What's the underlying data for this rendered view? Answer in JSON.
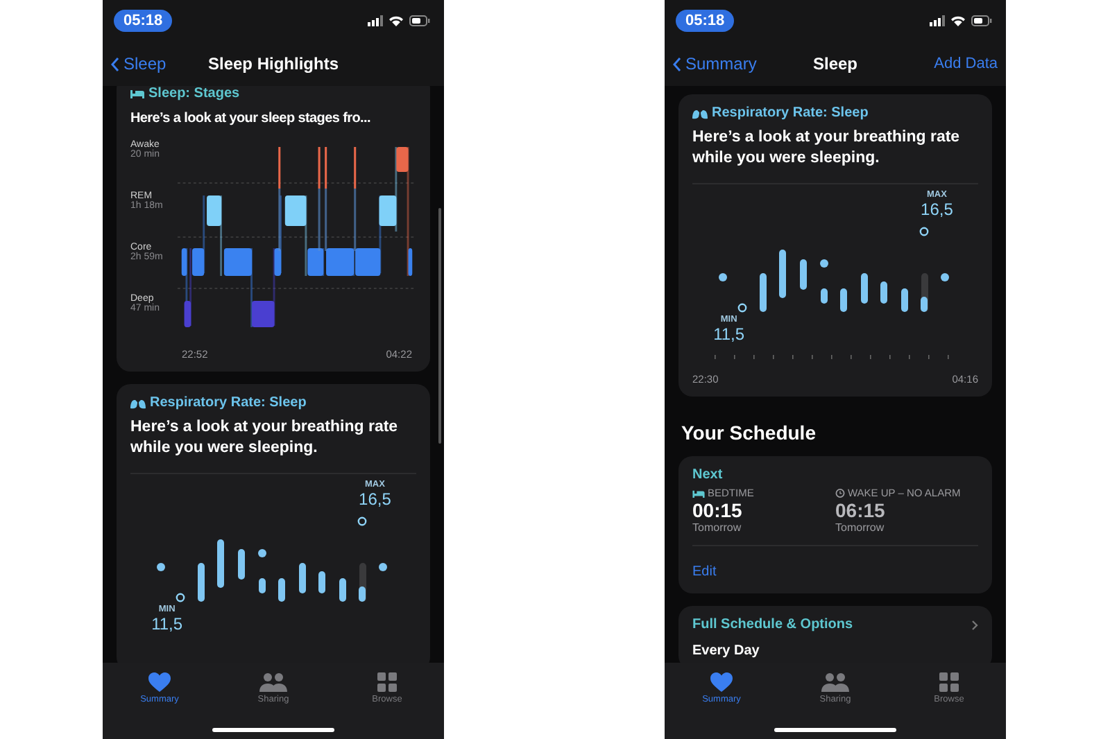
{
  "phones": [
    {
      "status_time": "05:18",
      "nav": {
        "back": "Sleep",
        "title": "Sleep Highlights"
      },
      "scrollbar": true,
      "cards": [
        {
          "kind": "stages",
          "title": "Sleep: Stages",
          "text": "Here’s a look at your sleep stages fro...",
          "stages": [
            {
              "name": "Awake",
              "duration": "20 min"
            },
            {
              "name": "REM",
              "duration": "1h 18m"
            },
            {
              "name": "Core",
              "duration": "2h 59m"
            },
            {
              "name": "Deep",
              "duration": "47 min"
            }
          ],
          "start": "22:52",
          "end": "04:22"
        },
        {
          "kind": "respiratory",
          "title": "Respiratory Rate: Sleep",
          "text": "Here’s a look at your breathing rate while you were sleeping.",
          "max_label": "MAX",
          "max": "16,5",
          "min_label": "MIN",
          "min": "11,5"
        }
      ],
      "tabs": [
        {
          "label": "Summary",
          "selected": true
        },
        {
          "label": "Sharing",
          "selected": false
        },
        {
          "label": "Browse",
          "selected": false
        }
      ]
    },
    {
      "status_time": "05:18",
      "nav": {
        "back": "Summary",
        "title": "Sleep",
        "action": "Add Data"
      },
      "scrollbar": false,
      "cards": [
        {
          "kind": "respiratory",
          "title": "Respiratory Rate: Sleep",
          "text": "Here’s a look at your breathing rate while you were sleeping.",
          "max_label": "MAX",
          "max": "16,5",
          "min_label": "MIN",
          "min": "11,5",
          "start": "22:30",
          "end": "04:16"
        },
        {
          "kind": "heading",
          "text": "Your Schedule"
        },
        {
          "kind": "schedule",
          "title": "Next",
          "items": [
            {
              "kind": "bed",
              "label": "BEDTIME",
              "time": "00:15",
              "day": "Tomorrow",
              "active": true
            },
            {
              "kind": "alarm",
              "label": "WAKE UP – NO ALARM",
              "time": "06:15",
              "day": "Tomorrow",
              "active": false
            }
          ],
          "link": "Edit"
        },
        {
          "kind": "options",
          "title": "Full Schedule & Options",
          "text": "Every Day"
        }
      ],
      "tabs": [
        {
          "label": "Summary",
          "selected": true
        },
        {
          "label": "Sharing",
          "selected": false
        },
        {
          "label": "Browse",
          "selected": false
        }
      ]
    }
  ]
}
